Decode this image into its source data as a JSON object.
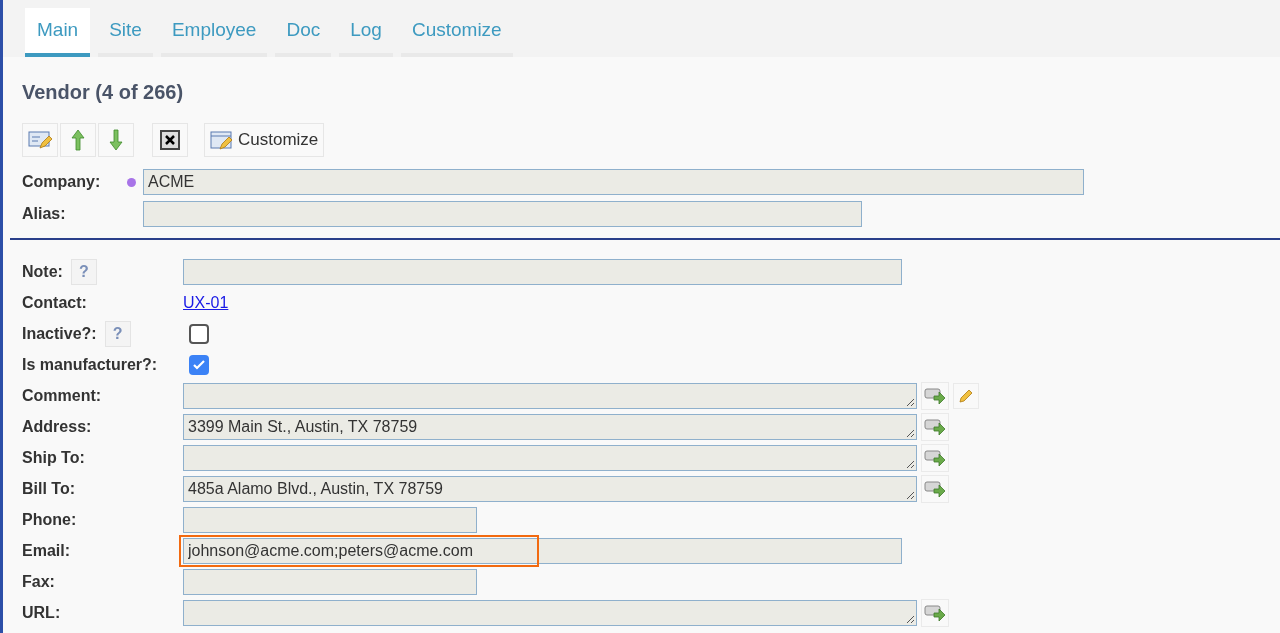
{
  "tabs": [
    {
      "label": "Main",
      "selected": true
    },
    {
      "label": "Site",
      "selected": false
    },
    {
      "label": "Employee",
      "selected": false
    },
    {
      "label": "Doc",
      "selected": false
    },
    {
      "label": "Log",
      "selected": false
    },
    {
      "label": "Customize",
      "selected": false
    }
  ],
  "title": "Vendor (4 of 266)",
  "toolbar": {
    "customize_label": "Customize"
  },
  "header_fields": [
    {
      "kind": "long",
      "label": "Company:",
      "value": "ACME",
      "required": true
    },
    {
      "kind": "medium",
      "label": "Alias:",
      "required": false
    }
  ],
  "fields": [
    {
      "kind": "text",
      "label": "Note:",
      "help": "?",
      "highlighted": false
    },
    {
      "kind": "link",
      "label": "Contact:",
      "value": "UX-01"
    },
    {
      "kind": "checkbox",
      "label": "Inactive?:",
      "help": "?",
      "checked": false
    },
    {
      "kind": "checkbox",
      "label": "Is manufacturer?:",
      "checked": true
    },
    {
      "kind": "textarea",
      "label": "Comment:",
      "editable": true
    },
    {
      "kind": "textarea",
      "label": "Address:",
      "value": "3399 Main St., Austin, TX 78759",
      "editable": false
    },
    {
      "kind": "textarea",
      "label": "Ship To:",
      "editable": false
    },
    {
      "kind": "textarea",
      "label": "Bill To:",
      "value": "485a Alamo Blvd., Austin, TX 78759",
      "editable": false
    },
    {
      "kind": "short",
      "label": "Phone:",
      "highlighted": false
    },
    {
      "kind": "text",
      "label": "Email:",
      "value": "johnson@acme.com;peters@acme.com",
      "highlighted": true
    },
    {
      "kind": "short",
      "label": "Fax:",
      "highlighted": false
    },
    {
      "kind": "textarea",
      "label": "URL:",
      "editable": false
    }
  ]
}
